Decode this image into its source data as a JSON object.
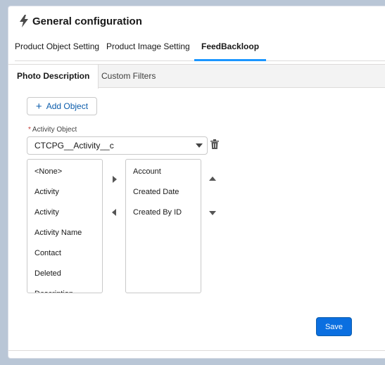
{
  "header": {
    "title": "General configuration"
  },
  "top_tabs": [
    {
      "label": "Product Object Setting"
    },
    {
      "label": "Product Image Setting"
    },
    {
      "label": "FeedBackloop",
      "active": true
    }
  ],
  "sub_tabs": [
    {
      "label": "Photo Description",
      "active": true
    },
    {
      "label": "Custom Filters"
    }
  ],
  "add_object": {
    "label": "Add Object",
    "icon": "plus-icon"
  },
  "activity_object": {
    "label": "Activity Object",
    "required_marker": "*",
    "value": "CTCPG__Activity__c"
  },
  "available_list": {
    "items": [
      "<None>",
      "Activity",
      "Activity",
      "Activity Name",
      "Contact",
      "Deleted",
      "Description"
    ]
  },
  "selected_list": {
    "items": [
      "Account",
      "Created Date",
      "Created By ID"
    ]
  },
  "save": {
    "label": "Save"
  },
  "colors": {
    "accent": "#1b96ff",
    "brand_button": "#0b6fe0",
    "required": "#c23934"
  }
}
